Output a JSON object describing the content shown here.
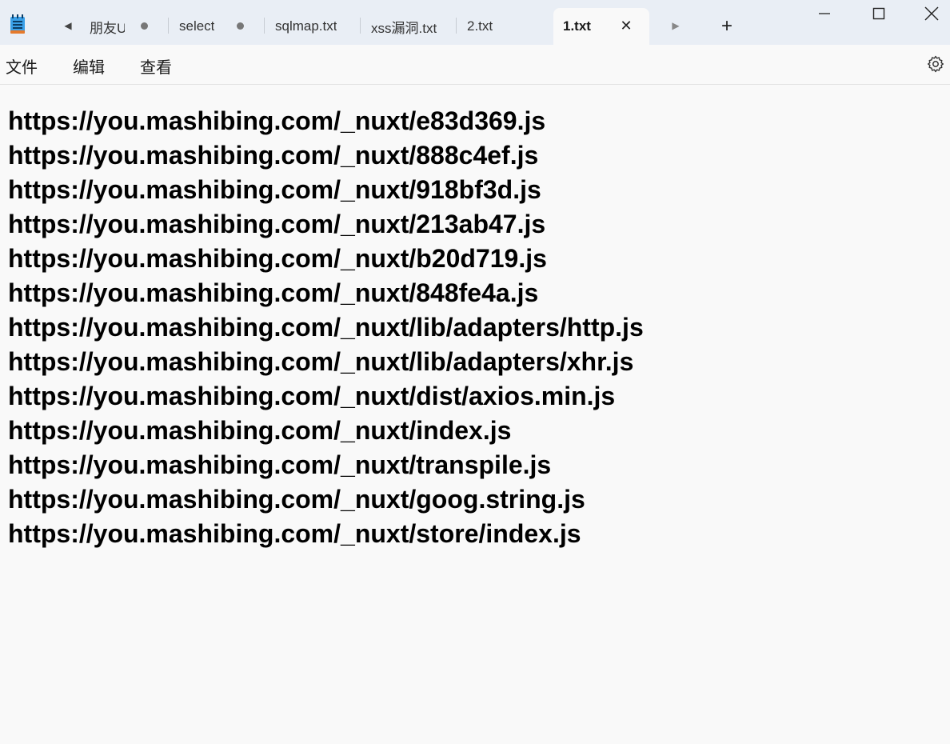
{
  "window": {
    "controls": {
      "minimize": "minimize-icon",
      "maximize": "maximize-icon",
      "close": "close-icon"
    }
  },
  "tabs": [
    {
      "label": "朋友U",
      "modified": true
    },
    {
      "label": "select",
      "modified": true
    },
    {
      "label": "sqlmap.txt",
      "modified": false
    },
    {
      "label": "xss漏洞.txt",
      "modified": false
    },
    {
      "label": "2.txt",
      "modified": false
    },
    {
      "label": "1.txt",
      "modified": false,
      "active": true
    }
  ],
  "menu": {
    "file": "文件",
    "edit": "编辑",
    "view": "查看"
  },
  "editor": {
    "lines": [
      "https://you.mashibing.com/_nuxt/e83d369.js",
      "https://you.mashibing.com/_nuxt/888c4ef.js",
      "https://you.mashibing.com/_nuxt/918bf3d.js",
      "https://you.mashibing.com/_nuxt/213ab47.js",
      "https://you.mashibing.com/_nuxt/b20d719.js",
      "https://you.mashibing.com/_nuxt/848fe4a.js",
      "https://you.mashibing.com/_nuxt/lib/adapters/http.js",
      "https://you.mashibing.com/_nuxt/lib/adapters/xhr.js",
      "https://you.mashibing.com/_nuxt/dist/axios.min.js",
      "https://you.mashibing.com/_nuxt/index.js",
      "https://you.mashibing.com/_nuxt/transpile.js",
      "https://you.mashibing.com/_nuxt/goog.string.js",
      "https://you.mashibing.com/_nuxt/store/index.js"
    ]
  },
  "colors": {
    "titlebar_bg": "#e9eef5",
    "editor_bg": "#f9f9f9",
    "text": "#000000"
  }
}
